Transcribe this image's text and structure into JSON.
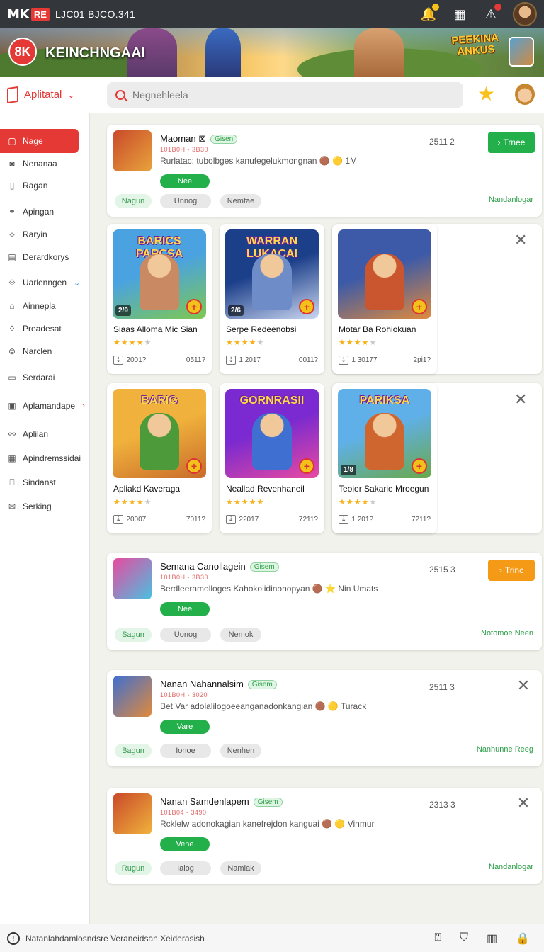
{
  "statusbar": {
    "logo_mark": "MK",
    "logo_badge": "RE",
    "title": "LJC01 BJCO.341",
    "icons": [
      "bell-icon",
      "calendar-icon",
      "alert-icon",
      "avatar"
    ]
  },
  "banner": {
    "brand_mark": "8K",
    "brand_name": "KEINCHNGAAI",
    "promo_line1": "PEEKINA",
    "promo_line2": "ANKUS"
  },
  "appbar": {
    "app_select_label": "Aplitatal",
    "search_placeholder": "Negnehleela"
  },
  "sidebar": {
    "items": [
      {
        "label": "Nage",
        "icon": "▢",
        "active": true
      },
      {
        "label": "Nenanaa",
        "icon": "◙"
      },
      {
        "label": "Ragan",
        "icon": "▯"
      },
      {
        "label": "Apingan",
        "icon": "⚭"
      },
      {
        "label": "Raryin",
        "icon": "⟡"
      },
      {
        "label": "Derardkorys",
        "icon": "▤"
      },
      {
        "label": "Uarlenngen",
        "icon": "⟐",
        "chevron": "⌄"
      },
      {
        "label": "Ainnepla",
        "icon": "⌂"
      },
      {
        "label": "Preadesat",
        "icon": "◊"
      },
      {
        "label": "Narclen",
        "icon": "⊚"
      },
      {
        "label": "Serdarai",
        "icon": "▭"
      },
      {
        "label": "Aplamandape",
        "icon": "▣",
        "chevron": "›"
      },
      {
        "label": "Aplilan",
        "icon": "⚯"
      },
      {
        "label": "Apindremssidai",
        "icon": "▦"
      },
      {
        "label": "Sindanst",
        "icon": "⎕"
      },
      {
        "label": "Serking",
        "icon": "✉"
      }
    ]
  },
  "list_cards": [
    {
      "title": "Maoman ⊠",
      "tag": "Gisen",
      "meta": "101B0H - 3B30",
      "desc": "Rurlatac: tubolbges kanufegelukmongnan 🟤 🟡 1M",
      "num": "2511 2",
      "pill": "Nee",
      "chips": [
        "Nagun",
        "Unnog",
        "Nemtae"
      ],
      "link": "Nandanlogar",
      "action": {
        "label": "Trnee",
        "color": "#23b04a",
        "glyph": "›"
      }
    },
    {
      "title": "Semana Canollagein",
      "tag": "Gisem",
      "meta": "101B0H - 3B30",
      "desc": "Berdleeramolloges Kahokolidinonopyan 🟤 ⭐ Nin Umats",
      "num": "2515 3",
      "pill": "Nee",
      "chips": [
        "Sagun",
        "Uonog",
        "Nemok"
      ],
      "link": "Notomoe Neen",
      "action": {
        "label": "Trinc",
        "color": "#f59a17",
        "glyph": "›"
      }
    },
    {
      "title": "Nanan Nahannalsim",
      "tag": "Gisem",
      "meta": "101B0H - 3020",
      "desc": "Bet Var adolalilogoeeanganadonkangian 🟤 🟡 Turack",
      "num": "2511 3",
      "pill": "Vare",
      "chips": [
        "Bagun",
        "Ionoe",
        "Nenhen"
      ],
      "link": "Nanhunne Reeg",
      "action": null
    },
    {
      "title": "Nanan Samdenlapem",
      "tag": "Gisem",
      "meta": "101B04 - 3490",
      "desc": "Rcklelw adonokagian kanefrejdon kanguai 🟤 🟡 Vinmur",
      "num": "2313 3",
      "pill": "Vene",
      "chips": [
        "Rugun",
        "Iaiog",
        "Namlak"
      ],
      "link": "Nandanlogar",
      "action": null
    }
  ],
  "tiles": [
    {
      "name": "Siaas Alloma Mic Sian",
      "logo": "BARICS PARCSA",
      "badge": "2/9",
      "stars_on": 4,
      "count": "2001?",
      "right": "0511?",
      "bg": "#4aa3e0",
      "bg2": "#7ec850",
      "fig": "#c98a63"
    },
    {
      "name": "Serpe Redeenobsi",
      "logo": "WARRAN LUKACAI",
      "badge": "2/6",
      "stars_on": 4,
      "count": "1 2017",
      "right": "0011?",
      "bg": "#1c3f8a",
      "bg2": "#c9d6f0",
      "fig": "#6d8cc8"
    },
    {
      "name": "Motar Ba Rohiokuan",
      "logo": "",
      "badge": "",
      "stars_on": 4,
      "count": "1 30177",
      "right": "2pi1?",
      "bg": "#3c5aa8",
      "bg2": "#e08a3c",
      "fig": "#c9562e"
    },
    {
      "name": "Apliakd Kaveraga",
      "logo": "BARIG",
      "badge": "",
      "stars_on": 4,
      "count": "20007",
      "right": "7011?",
      "bg": "#f0b23c",
      "bg2": "#c96b2a",
      "fig": "#4c9a3a"
    },
    {
      "name": "Neallad Revenhaneil",
      "logo": "GORNRASII",
      "badge": "",
      "stars_on": 5,
      "count": "22017",
      "right": "7211?",
      "bg": "#7a2ad0",
      "bg2": "#e84aa0",
      "fig": "#3f6fd0"
    },
    {
      "name": "Teoier Sakarie Mroegun",
      "logo": "PARIKSA",
      "badge": "1/8",
      "stars_on": 4,
      "count": "1 201?",
      "right": "7211?",
      "bg": "#5fb0e8",
      "bg2": "#6aa84a",
      "fig": "#d0662f"
    }
  ],
  "bottombar": {
    "text": "Natanlahdamlosndsre Veraneidsan Xeiderasish",
    "icons": [
      "help-icon",
      "shield-icon",
      "archive-icon",
      "lock-icon"
    ]
  }
}
